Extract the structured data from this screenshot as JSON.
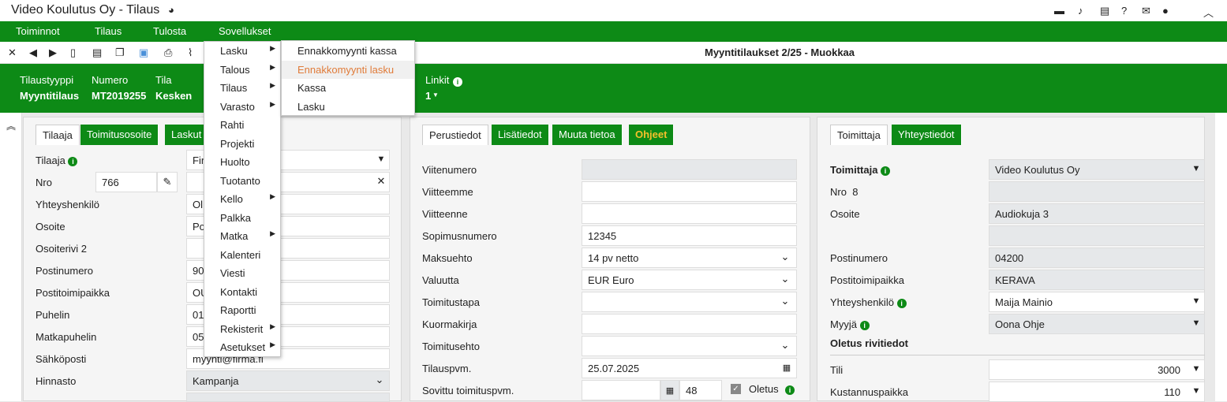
{
  "window": {
    "title": "Video Koulutus Oy - Tilaus"
  },
  "menubar": [
    "Toiminnot",
    "Tilaus",
    "Tulosta",
    "Sovellukset"
  ],
  "toolbar": {
    "title": "Myyntitilaukset 2/25 - Muokkaa"
  },
  "header": {
    "labels": [
      "Tilaustyyppi",
      "Numero",
      "Tila",
      "Linkit"
    ],
    "values": [
      "Myyntitilaus",
      "MT2019255",
      "Kesken",
      "1"
    ]
  },
  "sovellukset_menu": [
    "Lasku",
    "Talous",
    "Tilaus",
    "Varasto",
    "Rahti",
    "Projekti",
    "Huolto",
    "Tuotanto",
    "Kello",
    "Palkka",
    "Matka",
    "Kalenteri",
    "Viesti",
    "Kontakti",
    "Raportti",
    "Rekisterit",
    "Asetukset"
  ],
  "lasku_submenu": [
    "Ennakkomyynti kassa",
    "Ennakkomyynti lasku",
    "Kassa",
    "Lasku"
  ],
  "left_panel": {
    "tabs": [
      "Tilaaja",
      "Toimitusosoite",
      "Laskut"
    ],
    "labels": [
      "Tilaaja",
      "Nro",
      "Yhteyshenkilö",
      "Osoite",
      "Osoiterivi 2",
      "Postinumero",
      "Postitoimipaikka",
      "Puhelin",
      "Matkapuhelin",
      "Sähköposti",
      "Hinnasto"
    ],
    "nro_value": "766",
    "values": [
      "Fir",
      "",
      "Ol",
      "Po",
      "",
      "90",
      "OU",
      "01",
      "05",
      "myynti@firma.fi",
      "Kampanja"
    ]
  },
  "middle_panel": {
    "tabs": [
      "Perustiedot",
      "Lisätiedot",
      "Muuta tietoa",
      "Ohjeet"
    ],
    "labels": [
      "Viitenumero",
      "Viitteemme",
      "Viitteenne",
      "Sopimusnumero",
      "Maksuehto",
      "Valuutta",
      "Toimitustapa",
      "Kuormakirja",
      "Toimitusehto",
      "Tilauspvm.",
      "Sovittu toimituspvm."
    ],
    "values": [
      "",
      "",
      "",
      "12345",
      "14 pv netto",
      "EUR Euro",
      "",
      "",
      "",
      "25.07.2025",
      ""
    ],
    "week": "48",
    "oletus_label": "Oletus"
  },
  "right_panel": {
    "tabs": [
      "Toimittaja",
      "Yhteystiedot"
    ],
    "toimittaja_label": "Toimittaja",
    "toimittaja_value": "Video Koulutus Oy",
    "nro_label": "Nro",
    "nro_value": "8",
    "labels": [
      "Osoite",
      "",
      "Postinumero",
      "Postitoimipaikka",
      "Yhteyshenkilö",
      "Myyjä"
    ],
    "values": [
      "Audiokuja 3",
      "",
      "04200",
      "KERAVA",
      "Maija Mainio",
      "Oona Ohje"
    ],
    "section_title": "Oletus rivitiedot",
    "tili_label": "Tili",
    "tili_value": "3000",
    "kp_label": "Kustannuspaikka",
    "kp_value": "110"
  }
}
